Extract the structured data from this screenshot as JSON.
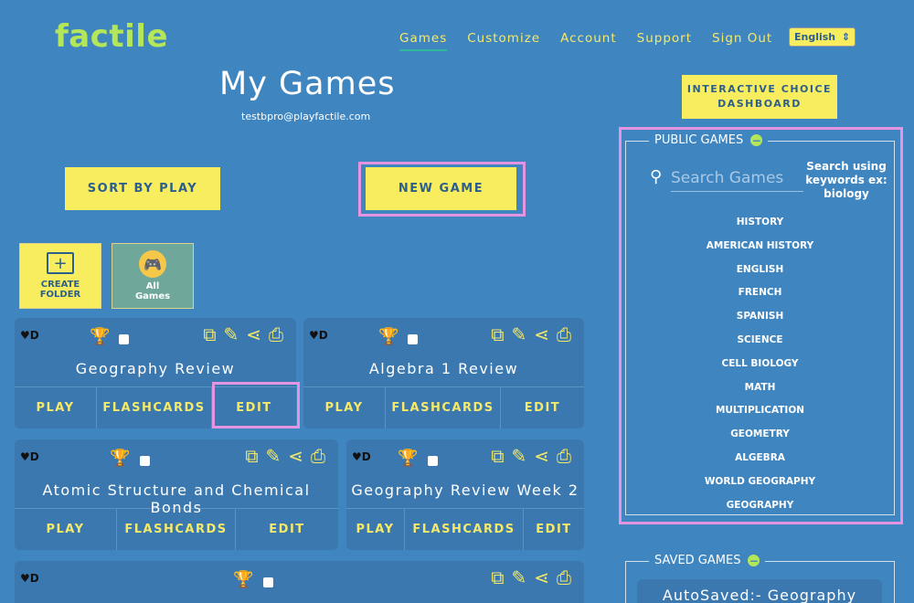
{
  "header": {
    "logo": "factile",
    "nav": [
      "Games",
      "Customize",
      "Account",
      "Support",
      "Sign Out"
    ],
    "language": "English"
  },
  "page": {
    "title": "My Games",
    "email": "testbpro@playfactile.com",
    "sort_label": "SORT BY PLAY",
    "new_game_label": "NEW GAME",
    "icd_label_1": "INTERACTIVE CHOICE",
    "icd_label_2": "DASHBOARD"
  },
  "folders": {
    "create_1": "CREATE",
    "create_2": "FOLDER",
    "all_1": "All",
    "all_2": "Games"
  },
  "card_common": {
    "hd": "♥D",
    "play": "PLAY",
    "flashcards": "FLASHCARDS",
    "edit": "EDIT"
  },
  "games": [
    {
      "name": "Geography Review"
    },
    {
      "name": "Algebra 1 Review"
    },
    {
      "name": "Atomic Structure and Chemical Bonds"
    },
    {
      "name": "Geography Review Week 2"
    },
    {
      "name": ""
    }
  ],
  "public_games": {
    "legend": "PUBLIC GAMES",
    "search_placeholder": "Search Games",
    "hint": "Search using keywords ex: biology",
    "topics": [
      "HISTORY",
      "AMERICAN HISTORY",
      "ENGLISH",
      "FRENCH",
      "SPANISH",
      "SCIENCE",
      "CELL BIOLOGY",
      "MATH",
      "MULTIPLICATION",
      "GEOMETRY",
      "ALGEBRA",
      "WORLD GEOGRAPHY",
      "GEOGRAPHY"
    ]
  },
  "saved_games": {
    "legend": "SAVED GAMES",
    "item": "AutoSaved:- Geography"
  }
}
